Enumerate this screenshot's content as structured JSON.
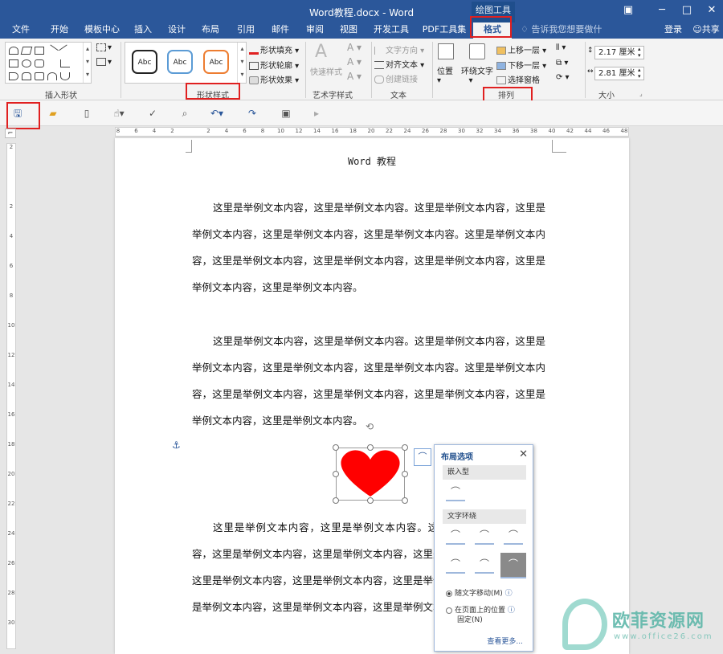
{
  "window": {
    "title": "Word教程.docx - Word",
    "context_tab_group": "绘图工具",
    "user_login": "登录",
    "share": "共享"
  },
  "tabs": [
    "文件",
    "开始",
    "模板中心",
    "插入",
    "设计",
    "布局",
    "引用",
    "邮件",
    "审阅",
    "视图",
    "开发工具",
    "PDF工具集",
    "格式"
  ],
  "tell_me": "告诉我您想要做什么...",
  "ribbon": {
    "groups": {
      "insert_shapes": "插入形状",
      "shape_styles": "形状样式",
      "art_styles": "艺术字样式",
      "text": "文本",
      "arrange": "排列",
      "size": "大小"
    },
    "style_preview_label": "Abc",
    "shape_fill": "形状填充",
    "shape_outline": "形状轮廓",
    "shape_effects": "形状效果",
    "quick_styles": "快速样式",
    "text_direction": "文字方向",
    "align_text": "对齐文本",
    "create_link": "创建链接",
    "position": "位置",
    "wrap_text": "环绕文字",
    "bring_forward": "上移一层",
    "send_backward": "下移一层",
    "selection_pane": "选择窗格",
    "height": "2.17 厘米",
    "width": "2.81 厘米"
  },
  "ruler_h": [
    "8",
    "6",
    "4",
    "2",
    "",
    "2",
    "4",
    "6",
    "8",
    "10",
    "12",
    "14",
    "16",
    "18",
    "20",
    "22",
    "24",
    "26",
    "28",
    "30",
    "32",
    "34",
    "36",
    "38",
    "40",
    "42",
    "44",
    "46",
    "48"
  ],
  "ruler_v": [
    "2",
    "",
    "2",
    "4",
    "6",
    "8",
    "10",
    "12",
    "14",
    "16",
    "18",
    "20",
    "22",
    "24",
    "26",
    "28",
    "30"
  ],
  "document": {
    "title": "Word 教程",
    "paragraphs": [
      "这里是举例文本内容，这里是举例文本内容。这里是举例文本内容，这里是举例文本内容，这里是举例文本内容，这里是举例文本内容。这里是举例文本内容，这里是举例文本内容，这里是举例文本内容，这里是举例文本内容，这里是举例文本内容，这里是举例文本内容。",
      "这里是举例文本内容，这里是举例文本内容。这里是举例文本内容，这里是举例文本内容，这里是举例文本内容，这里是举例文本内容。这里是举例文本内容，这里是举例文本内容，这里是举例文本内容，这里是举例文本内容，这里是举例文本内容，这里是举例文本内容。",
      "这里是举例文本内容，这里是举例文本内容。这里是举例文本内容，这里是举例文本内容，这里是举例文本内容，这里是举例文本内容。这里是举例文本内容，这里是举例文本内容，这里是举例文本内容，这里是举例文本内容，这里是举例文本内容，这里是举例文本内容，这里是举例文本内容，这里是举例文本内容。"
    ]
  },
  "layout_panel": {
    "title": "布局选项",
    "inline_section": "嵌入型",
    "wrap_section": "文字环绕",
    "option_move": "随文字移动(M)",
    "option_fix_1": "在页面上的位置",
    "option_fix_2": "固定(N)",
    "see_more": "查看更多..."
  },
  "watermark": {
    "brand": "欧菲资源网",
    "url": "www.office26.com"
  },
  "colors": {
    "accent": "#2b579a",
    "highlight": "#e02020",
    "heart": "#ff0000"
  }
}
